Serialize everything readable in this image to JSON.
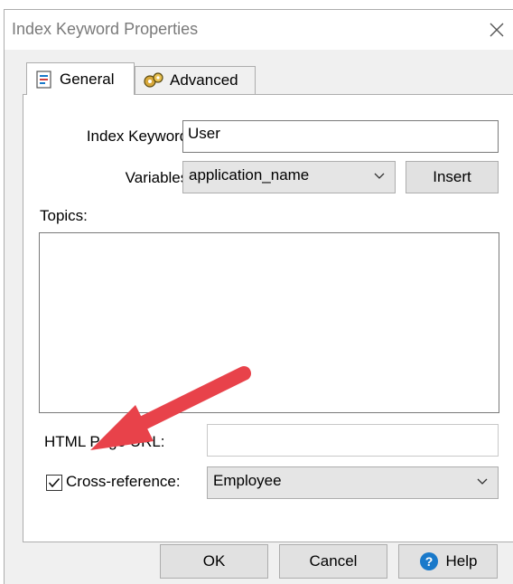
{
  "window": {
    "title": "Index Keyword Properties"
  },
  "tabs": [
    {
      "label": "General",
      "icon": "document-icon",
      "active": true
    },
    {
      "label": "Advanced",
      "icon": "gears-icon",
      "active": false
    }
  ],
  "general": {
    "index_keyword_label": "Index Keyword:",
    "index_keyword_value": "User",
    "variables_label": "Variables:",
    "variables_selected": "application_name",
    "insert_label": "Insert",
    "topics_label": "Topics:",
    "topics_items": [],
    "html_url_label": "HTML Page URL:",
    "html_url_value": "",
    "cross_reference_label": "Cross-reference:",
    "cross_reference_checked": true,
    "cross_reference_selected": "Employee"
  },
  "buttons": {
    "ok": "OK",
    "cancel": "Cancel",
    "help": "Help"
  },
  "colors": {
    "accent": "#1979ca",
    "arrow": "#e8424a",
    "dialog_bg": "#f0f0f0"
  }
}
